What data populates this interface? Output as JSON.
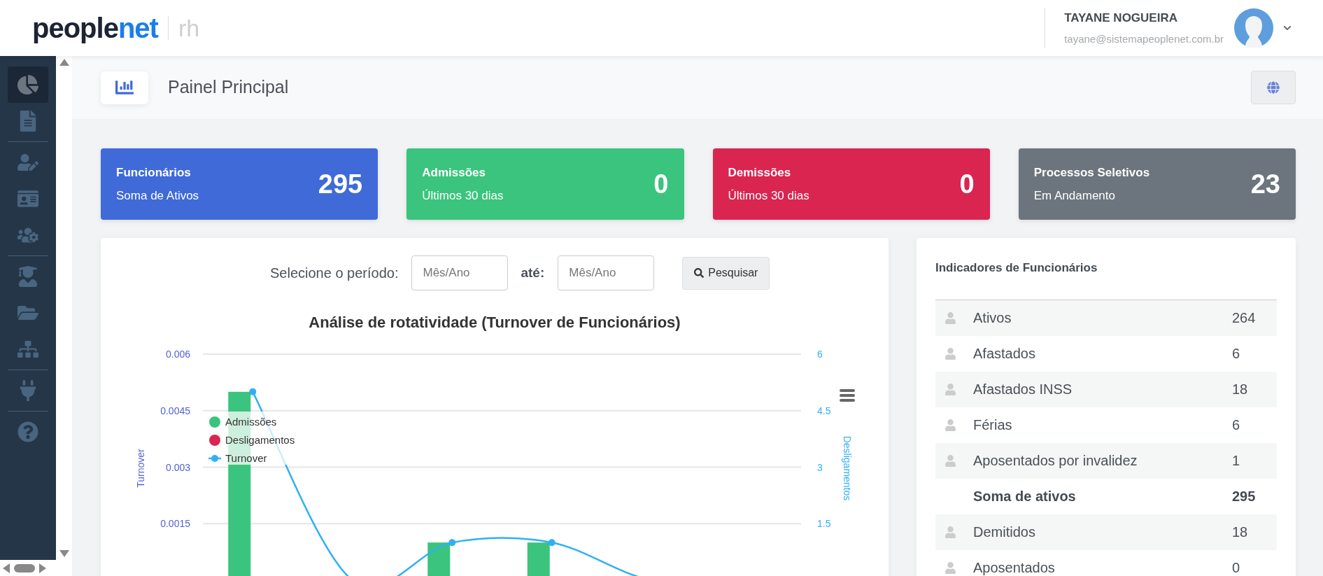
{
  "header": {
    "logo": {
      "main": "people",
      "accent": "net",
      "suffix": "rh"
    },
    "user": {
      "name": "TAYANE NOGUEIRA",
      "email": "tayane@sistemapeoplenet.com.br"
    }
  },
  "sidebar": {
    "groups": [
      {
        "items": [
          {
            "selected": true
          },
          {
            "selected": false
          }
        ]
      },
      {
        "items": [
          {
            "selected": false
          },
          {
            "selected": false
          },
          {
            "selected": false
          }
        ]
      },
      {
        "items": [
          {
            "selected": false
          },
          {
            "selected": false
          },
          {
            "selected": false
          }
        ]
      },
      {
        "items": [
          {
            "selected": false
          }
        ]
      },
      {
        "items": [
          {
            "selected": false
          }
        ]
      }
    ]
  },
  "page_title": "Painel Principal",
  "cards": [
    {
      "title": "Funcionários",
      "subtitle": "Soma de Ativos",
      "value": "295",
      "color": "#3f6ad8"
    },
    {
      "title": "Admissões",
      "subtitle": "Últimos 30 dias",
      "value": "0",
      "color": "#3ac47d"
    },
    {
      "title": "Demissões",
      "subtitle": "Últimos 30 dias",
      "value": "0",
      "color": "#d92550"
    },
    {
      "title": "Processos Seletivos",
      "subtitle": "Em Andamento",
      "value": "23",
      "color": "#6c757d"
    }
  ],
  "filter": {
    "label": "Selecione o período:",
    "from": {
      "placeholder": "Mês/Ano"
    },
    "to_label": "até:",
    "to": {
      "placeholder": "Mês/Ano"
    },
    "button": "Pesquisar"
  },
  "chart_data": {
    "type": "bar",
    "grid": true,
    "legend": "upper-left",
    "title": "Análise de rotatividade (Turnover de Funcionários)",
    "ylabel": "Turnover",
    "y2label": "Desligamentos",
    "ylim": [
      0,
      0.006
    ],
    "y2lim": [
      0,
      6
    ],
    "yticks": [
      {
        "value": 0.0015,
        "label": "0.0015"
      },
      {
        "value": 0.003,
        "label": "0.003"
      },
      {
        "value": 0.0045,
        "label": "0.0045"
      },
      {
        "value": 0.006,
        "label": "0.006"
      }
    ],
    "y2ticks": [
      {
        "value": 1.5,
        "label": "1.5"
      },
      {
        "value": 3,
        "label": "3"
      },
      {
        "value": 4.5,
        "label": "4.5"
      },
      {
        "value": 6,
        "label": "6"
      }
    ],
    "series": [
      {
        "name": "Admissões",
        "color": "#3ac47d",
        "type": "bar",
        "axis": "y2",
        "values": [
          5,
          0,
          1,
          1,
          0,
          0
        ]
      },
      {
        "name": "Desligamentos",
        "color": "#d92550",
        "type": "bar",
        "axis": "y2",
        "values": [
          0,
          0,
          0,
          0,
          0,
          0
        ]
      },
      {
        "name": "Turnover",
        "color": "#2fb0f5",
        "type": "line",
        "marker": "circle",
        "values": [
          0.005,
          0,
          0.001,
          0.001,
          0,
          0
        ]
      }
    ]
  },
  "indicators": {
    "title": "Indicadores de Funcionários",
    "rows": [
      {
        "kind": "item",
        "label": "Ativos",
        "value": "264"
      },
      {
        "kind": "item",
        "label": "Afastados",
        "value": "6"
      },
      {
        "kind": "item",
        "label": "Afastados INSS",
        "value": "18"
      },
      {
        "kind": "item",
        "label": "Férias",
        "value": "6"
      },
      {
        "kind": "item",
        "label": "Aposentados por invalidez",
        "value": "1"
      },
      {
        "kind": "total",
        "label": "Soma de ativos",
        "value": "295"
      },
      {
        "kind": "item",
        "label": "Demitidos",
        "value": "18"
      },
      {
        "kind": "item",
        "label": "Aposentados",
        "value": "0"
      }
    ]
  }
}
